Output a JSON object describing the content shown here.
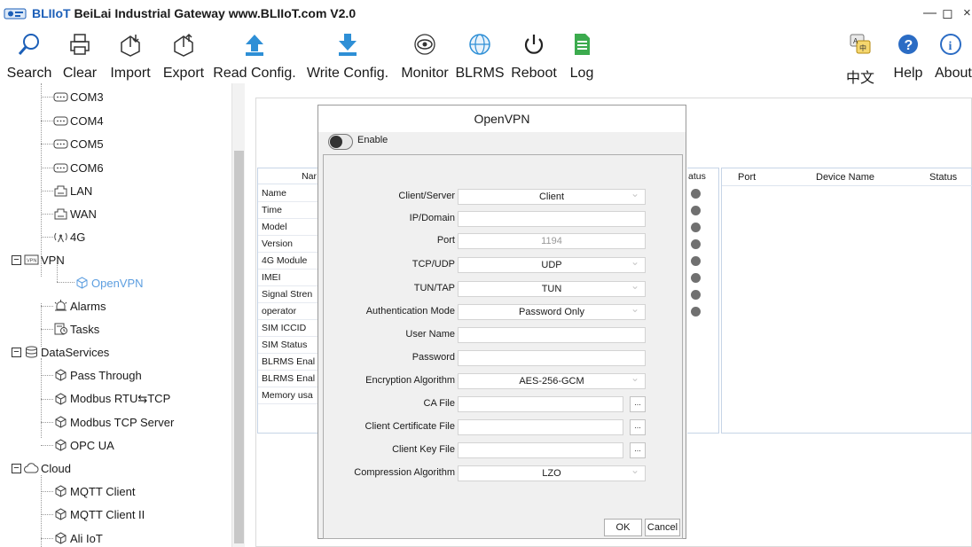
{
  "window": {
    "title_brand": "BLIIoT",
    "title_rest": "BeiLai Industrial Gateway www.BLIIoT.com V2.0",
    "minimize": "—",
    "maximize": "◻",
    "close": "×"
  },
  "toolbar": {
    "search": "Search",
    "clear": "Clear",
    "import": "Import",
    "export": "Export",
    "read_config": "Read Config.",
    "write_config": "Write Config.",
    "monitor": "Monitor",
    "blrms": "BLRMS",
    "reboot": "Reboot",
    "log": "Log",
    "language": "中文",
    "help": "Help",
    "about": "About"
  },
  "tree": {
    "com3": "COM3",
    "com4": "COM4",
    "com5": "COM5",
    "com6": "COM6",
    "lan": "LAN",
    "wan": "WAN",
    "fourg": "4G",
    "vpn": "VPN",
    "openvpn": "OpenVPN",
    "alarms": "Alarms",
    "tasks": "Tasks",
    "dataservices": "DataServices",
    "pass_through": "Pass Through",
    "modbus_rtu_tcp": "Modbus RTU⇆TCP",
    "modbus_tcp_server": "Modbus TCP Server",
    "opc_ua": "OPC UA",
    "cloud": "Cloud",
    "mqtt_client": "MQTT Client",
    "mqtt_client_2": "MQTT Client II",
    "ali_iot": "Ali IoT",
    "expander_minus": "−"
  },
  "info_table": {
    "header": "Nar",
    "rows": [
      "Name",
      "Time",
      "Model",
      "Version",
      "4G Module",
      "IMEI",
      "Signal Stren",
      "operator",
      "SIM ICCID",
      "SIM Status",
      "BLRMS Enal",
      "BLRMS Enal",
      "Memory usa"
    ],
    "status_header": "atus"
  },
  "port_table": {
    "port": "Port",
    "device_name": "Device Name",
    "status": "Status"
  },
  "dialog": {
    "title": "OpenVPN",
    "enable_label": "Enable",
    "enabled": false,
    "fields": {
      "client_server_label": "Client/Server",
      "client_server_value": "Client",
      "ip_domain_label": "IP/Domain",
      "ip_domain_value": "",
      "port_label": "Port",
      "port_value": "1194",
      "tcp_udp_label": "TCP/UDP",
      "tcp_udp_value": "UDP",
      "tun_tap_label": "TUN/TAP",
      "tun_tap_value": "TUN",
      "auth_mode_label": "Authentication Mode",
      "auth_mode_value": "Password Only",
      "user_name_label": "User Name",
      "user_name_value": "",
      "password_label": "Password",
      "password_value": "",
      "encryption_label": "Encryption Algorithm",
      "encryption_value": "AES-256-GCM",
      "ca_file_label": "CA File",
      "ca_file_value": "",
      "client_cert_label": "Client Certificate File",
      "client_cert_value": "",
      "client_key_label": "Client Key File",
      "client_key_value": "",
      "compression_label": "Compression Algorithm",
      "compression_value": "LZO",
      "browse": "..."
    },
    "ok": "OK",
    "cancel": "Cancel"
  },
  "colors": {
    "brand_blue": "#1c5fb8",
    "selected_node": "#5c9ee0",
    "dialog_bg": "#f0f0f0",
    "table_border": "#c6d4e6"
  }
}
